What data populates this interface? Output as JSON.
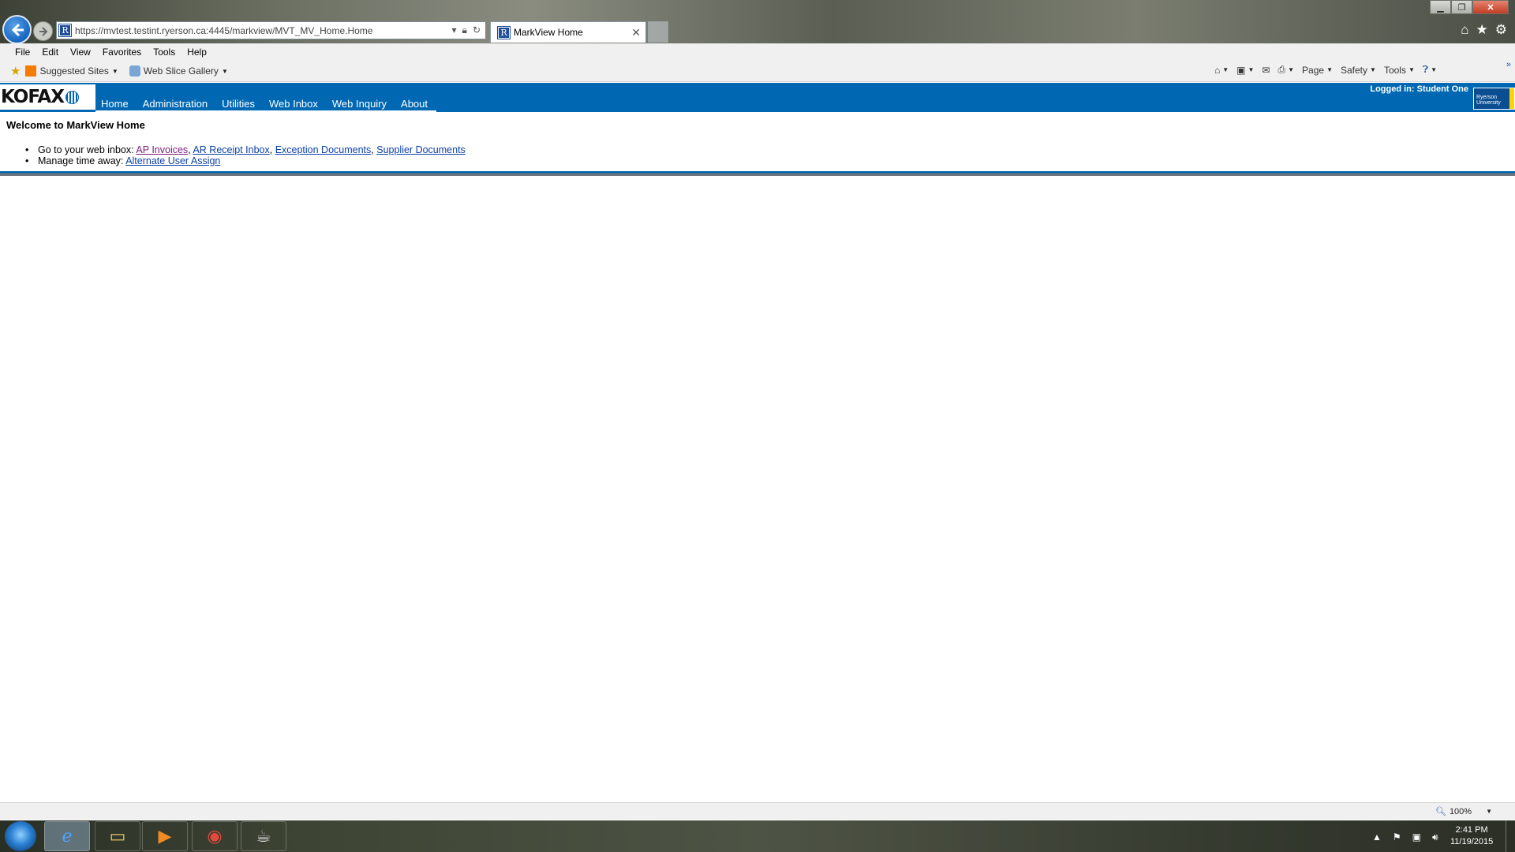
{
  "browser": {
    "address_url": "https://mvtest.testint.ryerson.ca:4445/markview/MVT_MV_Home.Home",
    "tab_title": "MarkView Home",
    "menu": [
      "File",
      "Edit",
      "View",
      "Favorites",
      "Tools",
      "Help"
    ],
    "favorites": [
      "Suggested Sites",
      "Web Slice Gallery"
    ],
    "command_bar": {
      "page": "Page",
      "safety": "Safety",
      "tools": "Tools"
    },
    "zoom": "100%"
  },
  "app": {
    "logo": "KOFAX",
    "nav": [
      "Home",
      "Administration",
      "Utilities",
      "Web Inbox",
      "Web Inquiry",
      "About"
    ],
    "logged_in": "Logged in: Student One",
    "institution": [
      "Ryerson",
      "University"
    ],
    "welcome": "Welcome to MarkView Home",
    "inbox_prefix": "Go to your web inbox:",
    "inbox_links": [
      "AP Invoices",
      "AR Receipt Inbox",
      "Exception Documents",
      "Supplier Documents"
    ],
    "time_away_prefix": "Manage time away:",
    "time_away_link": "Alternate User Assign"
  },
  "taskbar": {
    "time": "2:41 PM",
    "date": "11/19/2015"
  },
  "colors": {
    "app_header": "#0068b3",
    "link": "#0b3fa6",
    "visited_link": "#7b1a7b"
  }
}
